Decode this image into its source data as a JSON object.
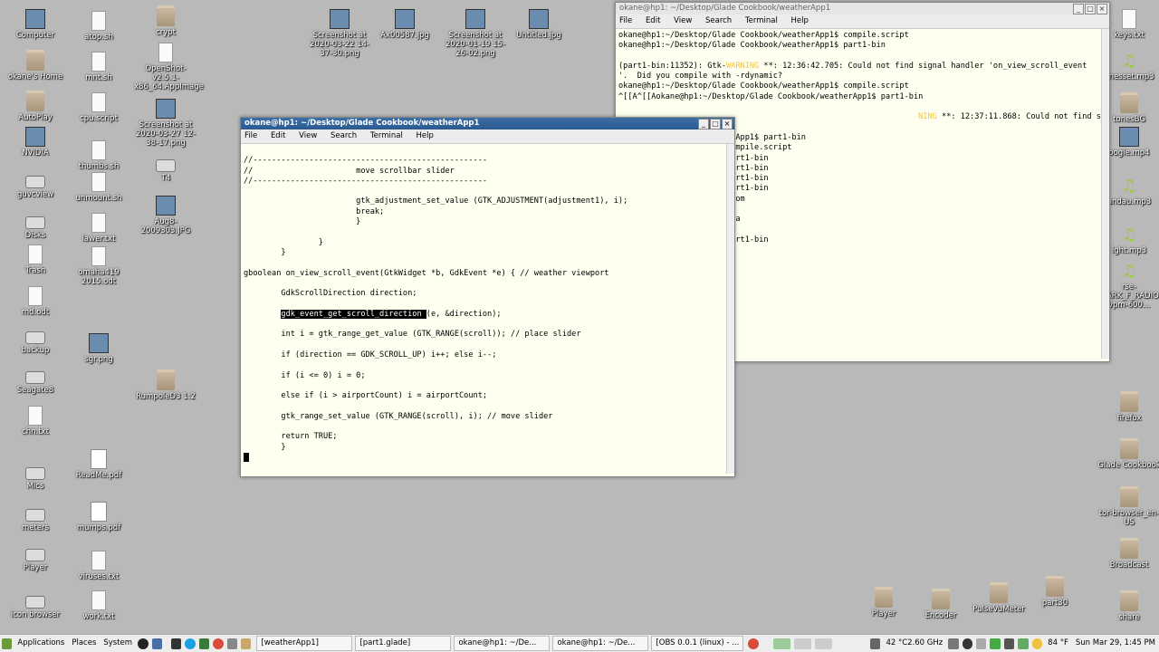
{
  "desktop": {
    "col1": [
      "Computer",
      "okane's Home",
      "AutoPlay",
      "NVIDIA",
      "guvcview",
      "Disks",
      "Trash",
      "md.odt",
      "backup",
      "Seagate8",
      "chn.txt",
      "Mics",
      "meters",
      "Player",
      "icon browser"
    ],
    "col2": [
      "atop.sh",
      "mnt.sh",
      "cpu.script",
      "thumbs.sh",
      "unmount.sh",
      "lawer.txt",
      "omaha419 2015.odt",
      "sgr.png",
      "ReadMe.pdf",
      "mumps.pdf",
      "viruses.txt",
      "work.txt"
    ],
    "col3": [
      "crypt",
      "OpenShot-v2.5.1-x86_64.AppImage",
      "Screenshot at 2020-03-27 12-38-17.png",
      "T4",
      "Aug8-2009303.JPG",
      "RumpoleD3 1:2"
    ],
    "top": [
      "Screenshot at 2020-03-22 14-37-30.png",
      "Ax00587.jpg",
      "Screenshot at 2020-01-19 15-26-02.png",
      "Untitled.jpg"
    ],
    "right": [
      "keys.txt",
      "onesset.mp3",
      "tonesBG",
      "oogie.mp4",
      "andau.mp3",
      "ight.mp3",
      "rse-SPARK_F_RADIO-vpm-600...",
      "firefox",
      "Glade Cookbook",
      "tor-browser_en-US",
      "Broadcast",
      "share"
    ],
    "bottom": [
      "Player",
      "Encoder",
      "PulseVuMeter",
      "part30"
    ]
  },
  "back_window": {
    "title": "okane@hp1: ~/Desktop/Glade Cookbook/weatherApp1",
    "menu": [
      "File",
      "Edit",
      "View",
      "Search",
      "Terminal",
      "Help"
    ],
    "lines": [
      "okane@hp1:~/Desktop/Glade Cookbook/weatherApp1$ compile.script",
      "okane@hp1:~/Desktop/Glade Cookbook/weatherApp1$ part1-bin",
      "",
      "(part1-bin:11352): Gtk-",
      "'.  Did you compile with -rdynamic?",
      "okane@hp1:~/Desktop/Glade Cookbook/weatherApp1$ compile.script",
      "^[[A^[[Aokane@hp1:~/Desktop/Glade Cookbook/weatherApp1$ part1-bin",
      "",
      "",
      " -rdynamic?",
      "op/Glade Cookbook/weatherApp1$ part1-bin",
      " Cookbook/weatherApp1$ compile.script",
      " Cookbook/weatherApp1$ part1-bin",
      " Cookbook/weatherApp1$ part1-bin",
      " Cookbook/weatherApp1$ part1-bin",
      " Cookbook/weatherApp1$ part1-bin",
      " Cookbook/weatherApp1$ !com",
      "",
      " Cookbook/weatherApp1$ !pa",
      "",
      " Cookbook/weatherApp1$ part1-bin",
      " Cookbook/weatherApp1$ "
    ],
    "warn_word": "WARNING",
    "warn_rest1": " **: 12:36:42.705: Could not find signal handler 'on_view_scroll_event",
    "warn_rest2": " **: 12:37:11.868: Could not find signal handler 'on_view_scroll_event"
  },
  "front_window": {
    "title": "okane@hp1: ~/Desktop/Glade Cookbook/weatherApp1",
    "menu": [
      "File",
      "Edit",
      "View",
      "Search",
      "Terminal",
      "Help"
    ],
    "lines": [
      "",
      "//--------------------------------------------------",
      "//                      move scrollbar slider",
      "//--------------------------------------------------",
      "",
      "                        gtk_adjustment_set_value (GTK_ADJUSTMENT(adjustment1), i);",
      "                        break;",
      "                        }",
      "",
      "                }",
      "        }",
      "",
      "gboolean on_view_scroll_event(GtkWidget *b, GdkEvent *e) { // weather viewport",
      "",
      "        GdkScrollDirection direction;",
      "",
      "",
      "",
      "        int i = gtk_range_get_value (GTK_RANGE(scroll)); // place slider",
      "",
      "        if (direction == GDK_SCROLL_UP) i++; else i--;",
      "",
      "        if (i <= 0) i = 0;",
      "",
      "        else if (i > airportCount) i = airportCount;",
      "",
      "        gtk_range_set_value (GTK_RANGE(scroll), i); // move slider",
      "",
      "        return TRUE;",
      "        }"
    ],
    "selected_text": "gdk_event_get_scroll_direction ",
    "after_selected": "(e, &direction);"
  },
  "taskbar": {
    "applications": "Applications",
    "places": "Places",
    "system": "System",
    "tasks": [
      "[weatherApp1]",
      "[part1.glade]",
      "okane@hp1: ~/De...",
      "okane@hp1: ~/De...",
      "[OBS 0.0.1 (linux) - ..."
    ],
    "cpu": "42 °C2.60 GHz",
    "weather": "84 °F",
    "clock": "Sun Mar 29,  1:45 PM"
  }
}
